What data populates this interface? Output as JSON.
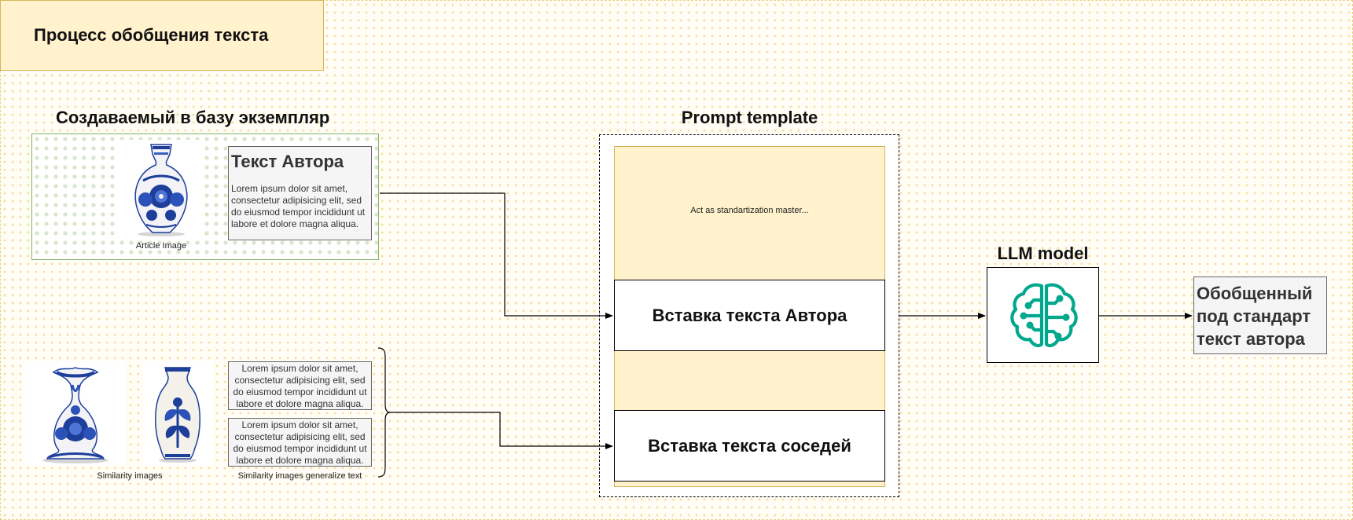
{
  "title": "Процесс обобщения текста",
  "instance": {
    "heading": "Создаваемый в базу экземпляр",
    "author_title": "Текст Автора",
    "author_text": "Lorem ipsum dolor sit amet, consectetur adipisicing elit, sed do eiusmod tempor incididunt ut labore et dolore magna aliqua.",
    "image_caption": "Article Image"
  },
  "similar": {
    "images_caption": "Similarity images",
    "texts_caption": "Similarity images generalize text",
    "texts": [
      "Lorem ipsum dolor sit amet, consectetur adipisicing elit, sed do eiusmod tempor incididunt ut labore et dolore magna aliqua.",
      "Lorem ipsum dolor sit amet, consectetur adipisicing elit, sed do eiusmod tempor incididunt ut labore et dolore magna aliqua."
    ]
  },
  "prompt": {
    "heading": "Prompt template",
    "instruction": "Act as standartization master...",
    "insert_author": "Вставка текста Автора",
    "insert_neighbors": "Вставка текста соседей"
  },
  "llm": {
    "heading": "LLM model",
    "icon": "ai-brain-icon",
    "icon_color": "#01a88d"
  },
  "result": {
    "lines": [
      "Обобщенный",
      "под стандарт",
      "текст автора"
    ]
  },
  "colors": {
    "note_fill": "#fff2cc",
    "note_border": "#d6b656",
    "group_border": "#82b366",
    "porcelain_blue": "#1d3f9a"
  }
}
